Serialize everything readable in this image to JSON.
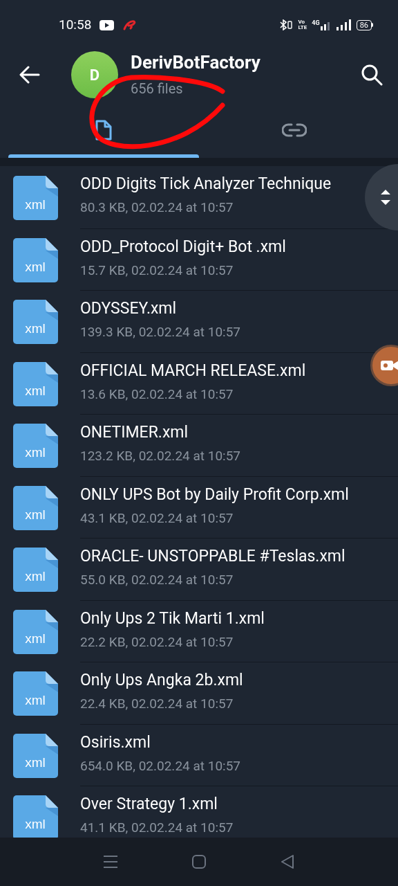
{
  "status_bar": {
    "time": "10:58",
    "volte_top": "Vo",
    "volte_bottom": "LTE",
    "network": "4G",
    "battery": "86"
  },
  "header": {
    "avatar_letter": "D",
    "title": "DerivBotFactory",
    "subtitle": "656 files"
  },
  "tabs": [
    {
      "kind": "files",
      "selected": true
    },
    {
      "kind": "links",
      "selected": false
    }
  ],
  "files": [
    {
      "icon_label": "xml",
      "name": "ODD Digits Tick Analyzer Technique",
      "meta": "80.3 KB, 02.02.24 at 10:57"
    },
    {
      "icon_label": "xml",
      "name": "ODD_Protocol Digit+ Bot .xml",
      "meta": "15.7 KB, 02.02.24 at 10:57"
    },
    {
      "icon_label": "xml",
      "name": "ODYSSEY.xml",
      "meta": "139.3 KB, 02.02.24 at 10:57"
    },
    {
      "icon_label": "xml",
      "name": "OFFICIAL MARCH RELEASE.xml",
      "meta": "13.6 KB, 02.02.24 at 10:57"
    },
    {
      "icon_label": "xml",
      "name": "ONETIMER.xml",
      "meta": "123.2 KB, 02.02.24 at 10:57"
    },
    {
      "icon_label": "xml",
      "name": "ONLY UPS Bot by Daily Profit Corp.xml",
      "meta": "43.1 KB, 02.02.24 at 10:57"
    },
    {
      "icon_label": "xml",
      "name": "ORACLE- UNSTOPPABLE #Teslas.xml",
      "meta": "55.0 KB, 02.02.24 at 10:57"
    },
    {
      "icon_label": "xml",
      "name": "Only Ups 2 Tik Marti 1.xml",
      "meta": "22.2 KB, 02.02.24 at 10:57"
    },
    {
      "icon_label": "xml",
      "name": "Only Ups Angka 2b.xml",
      "meta": "22.4 KB, 02.02.24 at 10:57"
    },
    {
      "icon_label": "xml",
      "name": "Osiris.xml",
      "meta": "654.0 KB, 02.02.24 at 10:57"
    },
    {
      "icon_label": "xml",
      "name": "Over Strategy 1.xml",
      "meta": "41.1 KB, 02.02.24 at 10:57"
    }
  ]
}
